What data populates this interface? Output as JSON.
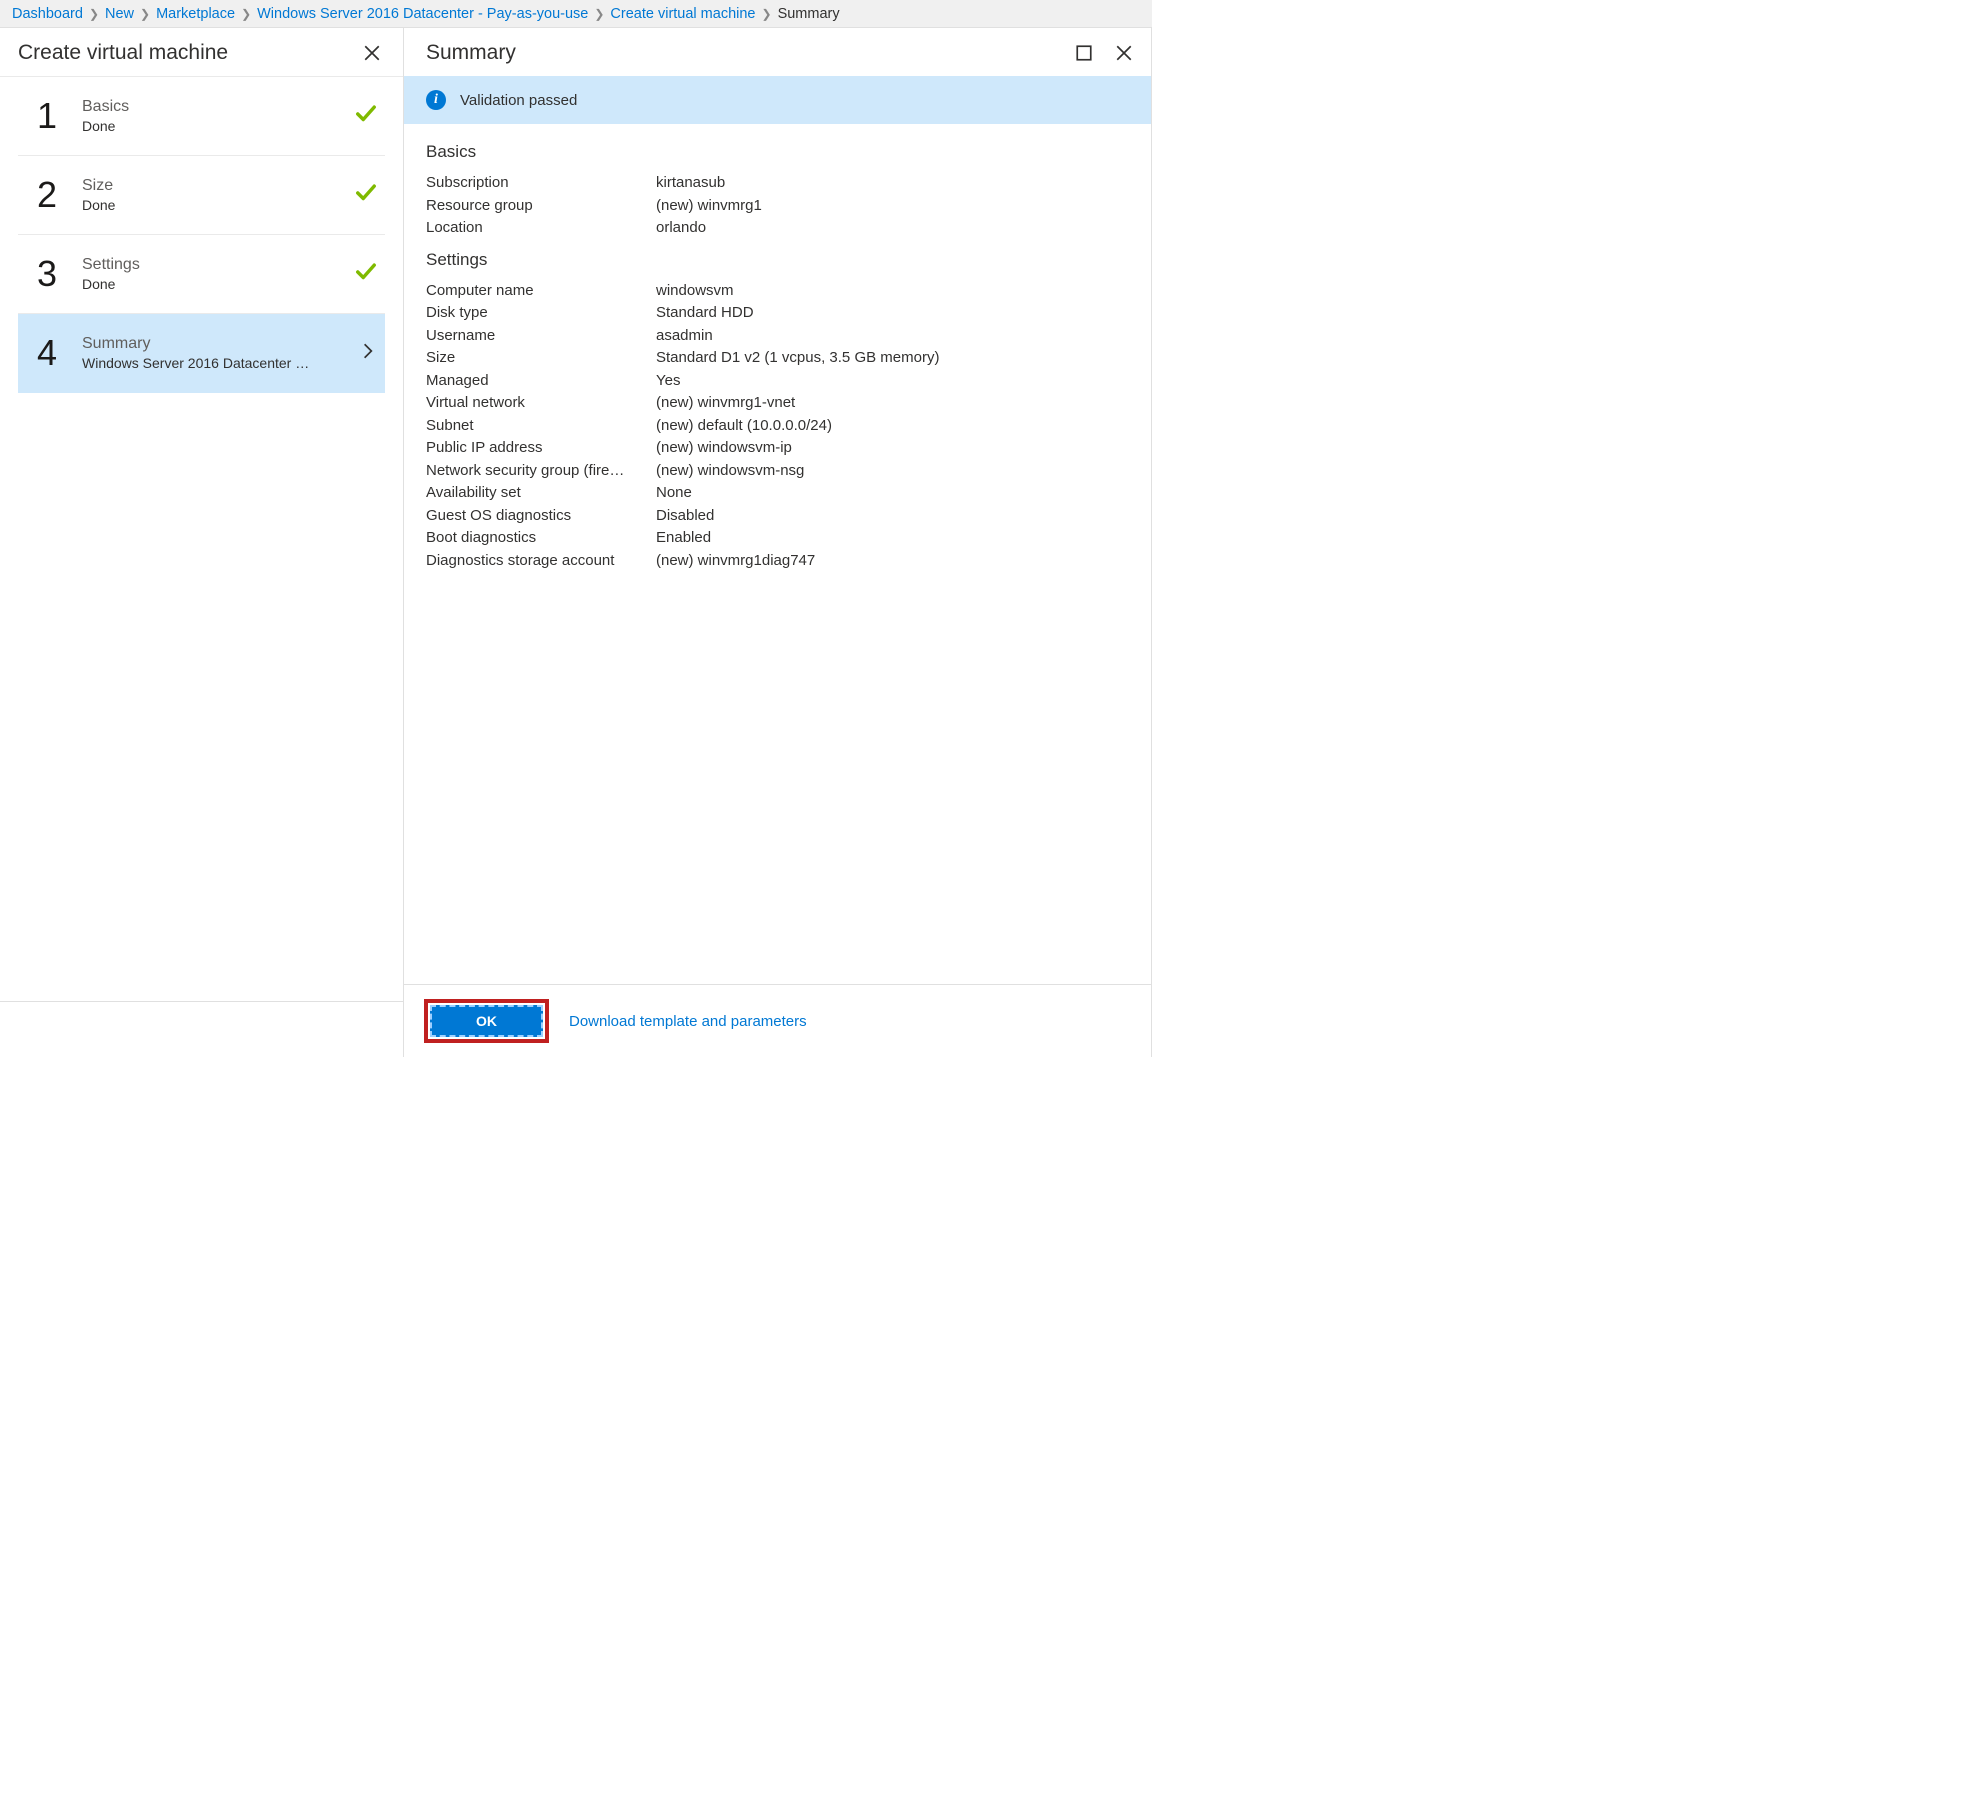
{
  "breadcrumb": {
    "items": [
      {
        "label": "Dashboard"
      },
      {
        "label": "New"
      },
      {
        "label": "Marketplace"
      },
      {
        "label": "Windows Server 2016 Datacenter - Pay-as-you-use"
      },
      {
        "label": "Create virtual machine"
      }
    ],
    "current": "Summary"
  },
  "leftBlade": {
    "title": "Create virtual machine",
    "steps": [
      {
        "num": "1",
        "title": "Basics",
        "sub": "Done",
        "state": "done"
      },
      {
        "num": "2",
        "title": "Size",
        "sub": "Done",
        "state": "done"
      },
      {
        "num": "3",
        "title": "Settings",
        "sub": "Done",
        "state": "done"
      },
      {
        "num": "4",
        "title": "Summary",
        "sub": "Windows Server 2016 Datacenter …",
        "state": "active"
      }
    ]
  },
  "rightBlade": {
    "title": "Summary",
    "validation": "Validation passed",
    "sections": [
      {
        "title": "Basics",
        "rows": [
          {
            "key": "Subscription",
            "val": "kirtanasub"
          },
          {
            "key": "Resource group",
            "val": "(new) winvmrg1"
          },
          {
            "key": "Location",
            "val": "orlando"
          }
        ]
      },
      {
        "title": "Settings",
        "rows": [
          {
            "key": "Computer name",
            "val": "windowsvm"
          },
          {
            "key": "Disk type",
            "val": "Standard HDD"
          },
          {
            "key": "Username",
            "val": "asadmin"
          },
          {
            "key": "Size",
            "val": "Standard D1 v2 (1 vcpus, 3.5 GB memory)"
          },
          {
            "key": "Managed",
            "val": "Yes"
          },
          {
            "key": "Virtual network",
            "val": "(new) winvmrg1-vnet"
          },
          {
            "key": "Subnet",
            "val": "(new) default (10.0.0.0/24)"
          },
          {
            "key": "Public IP address",
            "val": "(new) windowsvm-ip"
          },
          {
            "key": "Network security group (fire…",
            "val": "(new) windowsvm-nsg"
          },
          {
            "key": "Availability set",
            "val": "None"
          },
          {
            "key": "Guest OS diagnostics",
            "val": "Disabled"
          },
          {
            "key": "Boot diagnostics",
            "val": "Enabled"
          },
          {
            "key": "Diagnostics storage account",
            "val": "(new) winvmrg1diag747"
          }
        ]
      }
    ],
    "okLabel": "OK",
    "downloadLabel": "Download template and parameters"
  }
}
